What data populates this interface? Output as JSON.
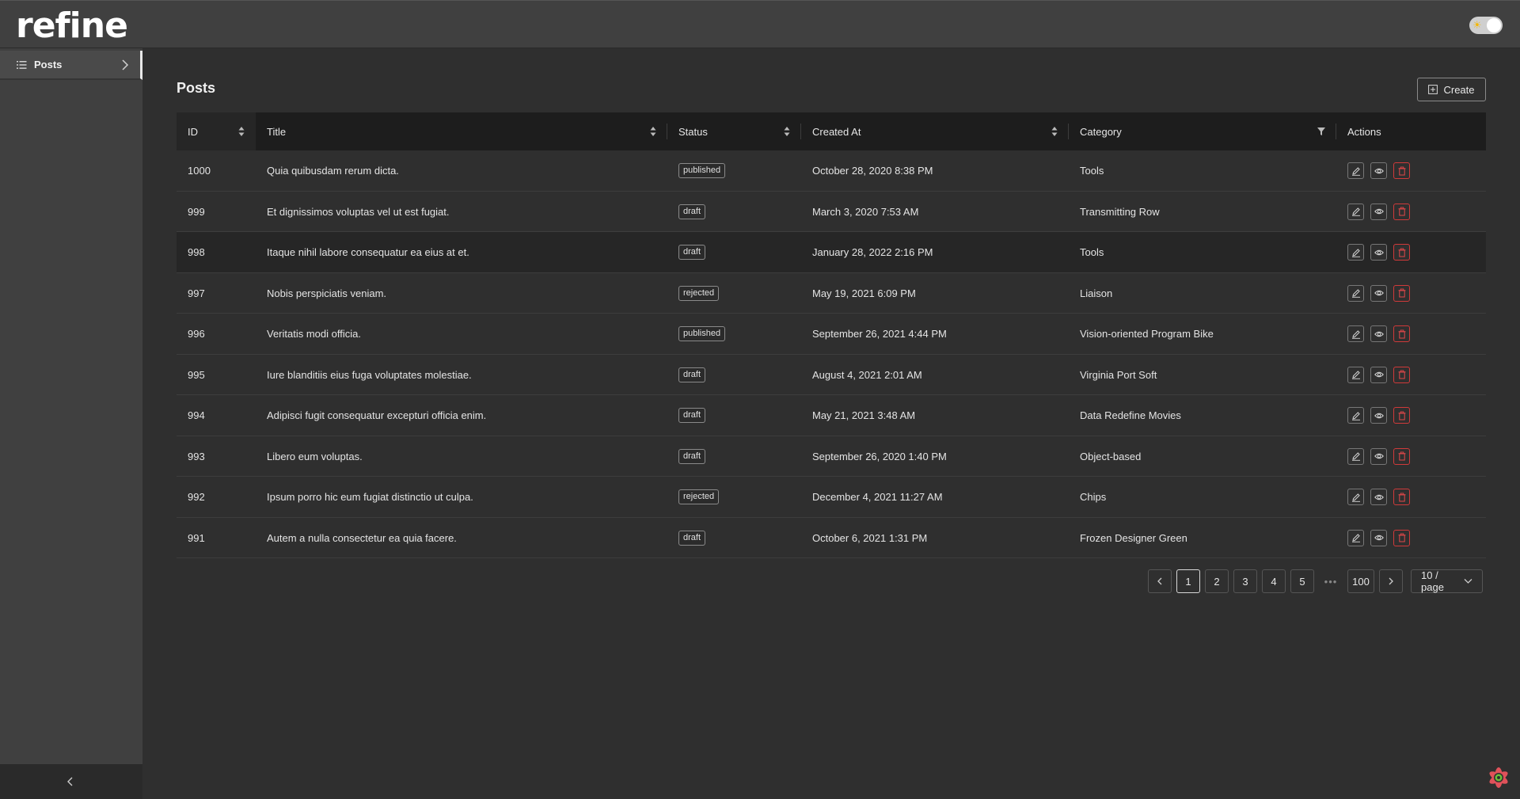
{
  "header": {
    "logo": "refine"
  },
  "sidebar": {
    "items": [
      {
        "label": "Posts"
      }
    ]
  },
  "main": {
    "title": "Posts",
    "create_label": "Create"
  },
  "table": {
    "columns": [
      "ID",
      "Title",
      "Status",
      "Created At",
      "Category",
      "Actions"
    ],
    "rows": [
      {
        "id": "1000",
        "title": "Quia quibusdam rerum dicta.",
        "status": "published",
        "created_at": "October 28, 2020 8:38 PM",
        "category": "Tools"
      },
      {
        "id": "999",
        "title": "Et dignissimos voluptas vel ut est fugiat.",
        "status": "draft",
        "created_at": "March 3, 2020 7:53 AM",
        "category": "Transmitting Row"
      },
      {
        "id": "998",
        "title": "Itaque nihil labore consequatur ea eius at et.",
        "status": "draft",
        "created_at": "January 28, 2022 2:16 PM",
        "category": "Tools"
      },
      {
        "id": "997",
        "title": "Nobis perspiciatis veniam.",
        "status": "rejected",
        "created_at": "May 19, 2021 6:09 PM",
        "category": "Liaison"
      },
      {
        "id": "996",
        "title": "Veritatis modi officia.",
        "status": "published",
        "created_at": "September 26, 2021 4:44 PM",
        "category": "Vision-oriented Program Bike"
      },
      {
        "id": "995",
        "title": "Iure blanditiis eius fuga voluptates molestiae.",
        "status": "draft",
        "created_at": "August 4, 2021 2:01 AM",
        "category": "Virginia Port Soft"
      },
      {
        "id": "994",
        "title": "Adipisci fugit consequatur excepturi officia enim.",
        "status": "draft",
        "created_at": "May 21, 2021 3:48 AM",
        "category": "Data Redefine Movies"
      },
      {
        "id": "993",
        "title": "Libero eum voluptas.",
        "status": "draft",
        "created_at": "September 26, 2020 1:40 PM",
        "category": "Object-based"
      },
      {
        "id": "992",
        "title": "Ipsum porro hic eum fugiat distinctio ut culpa.",
        "status": "rejected",
        "created_at": "December 4, 2021 11:27 AM",
        "category": "Chips"
      },
      {
        "id": "991",
        "title": "Autem a nulla consectetur ea quia facere.",
        "status": "draft",
        "created_at": "October 6, 2021 1:31 PM",
        "category": "Frozen Designer Green"
      }
    ]
  },
  "pagination": {
    "pages": [
      "1",
      "2",
      "3",
      "4",
      "5"
    ],
    "ellipsis": "•••",
    "last_page": "100",
    "current": "1",
    "page_size": "10 / page"
  },
  "icons": {
    "sidebar_item": "list-icon",
    "create": "plus-square-icon",
    "edit": "edit-icon",
    "show": "eye-icon",
    "delete": "trash-icon",
    "sort": "sort-icon",
    "filter": "filter-icon"
  },
  "colors": {
    "background": "#2f2f2f",
    "header": "#404040",
    "table_header": "#1d1d1d",
    "danger": "#d03a3a"
  }
}
